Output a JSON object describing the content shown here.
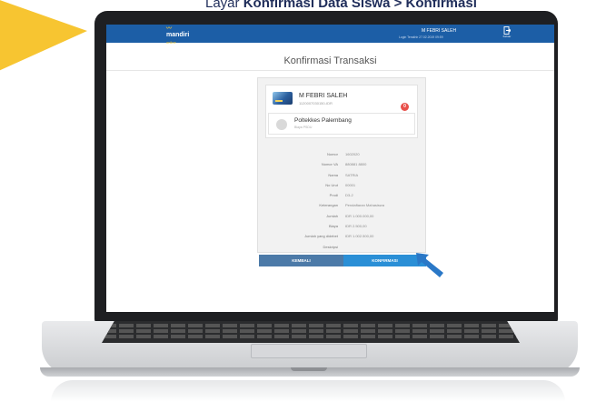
{
  "caption": {
    "prefix": "Layar ",
    "bold": "Konfirmasi Data Siswa > Konfirmasi"
  },
  "topbar": {
    "brand": "mandiri",
    "brand_sub": "online",
    "user_name": "M FEBRI SALEH",
    "login_time": "Login Terakhir 27.02.2019 09:59",
    "logout_label": "Keluar",
    "logout_icon": "logout-icon",
    "color": "#1c5ea6"
  },
  "page": {
    "title": "Konfirmasi Transaksi"
  },
  "account": {
    "name": "M FEBRI SALEH",
    "number": "1120007030150-IDR"
  },
  "institution": {
    "name": "Poltekkes Palembang",
    "sub": "Biaya PSDU",
    "badge": "0"
  },
  "details": [
    {
      "label": "Nomor",
      "value": "1602020"
    },
    {
      "label": "Nomor VA",
      "value": "880881 8800"
    },
    {
      "label": "Nama",
      "value": "SATRIA"
    },
    {
      "label": "No Urut",
      "value": "00001"
    },
    {
      "label": "Prodi",
      "value": "D3-2"
    },
    {
      "label": "Keterangan",
      "value": "Pendaftaran Mahasiswa"
    },
    {
      "label": "Jumlah",
      "value": "IDR 1.000.000,00"
    },
    {
      "label": "Biaya",
      "value": "IDR 2.500,00"
    },
    {
      "label": "Jumlah yang didebet",
      "value": "IDR 1.002.500,00"
    },
    {
      "label": "Deskripsi",
      "value": ""
    }
  ],
  "buttons": {
    "back": "KEMBALI",
    "confirm": "KONFIRMASI"
  },
  "colors": {
    "accent": "#f7c531",
    "button_back": "#4c7aa8",
    "button_confirm": "#2a8fd6",
    "pointer": "#2a78c7"
  }
}
